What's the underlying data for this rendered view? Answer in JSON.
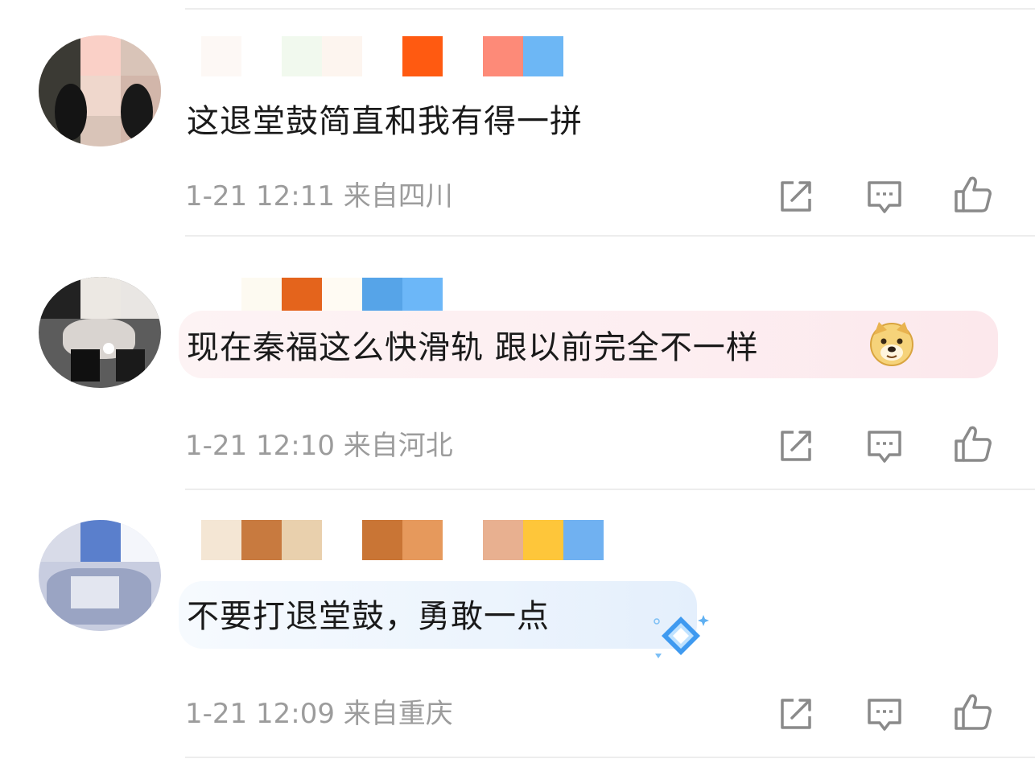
{
  "comments": [
    {
      "text": "这退堂鼓简直和我有得一拼",
      "time": "1-21 12:11",
      "location": "来自四川",
      "avatar_icon": "avatar-girl-icon",
      "name_blocks": [
        "#fdf8f5",
        "#f1f9ee",
        "#fdf5ef",
        "#ff5a11",
        "#fd8a78",
        "#6db7f5"
      ]
    },
    {
      "text": "现在秦福这么快滑轨 跟以前完全不一样",
      "emoji": "doge-emoji-icon",
      "time": "1-21 12:10",
      "location": "来自河北",
      "avatar_icon": "avatar-plush-icon",
      "name_blocks": [
        "#f7fafc",
        "#fdfaf1",
        "#e4641c",
        "#fffbf3",
        "#56a4e8",
        "#6cb7f8"
      ]
    },
    {
      "text": "不要打退堂鼓，勇敢一点",
      "sticker": "blue-diamond-sticker-icon",
      "time": "1-21 12:09",
      "location": "来自重庆",
      "avatar_icon": "avatar-anime-icon",
      "name_blocks": [
        "#f4e6d4",
        "#c87a3f",
        "#e9d0ad",
        "#c97535",
        "#e6995c",
        "#e8b090",
        "#fec63a",
        "#70b1f1"
      ]
    }
  ],
  "actions": {
    "share_icon": "share-icon",
    "comment_icon": "comment-icon",
    "like_icon": "thumbs-up-icon"
  },
  "colors": {
    "bubble_pink": "#fdecef",
    "bubble_blue": "#e9f3fd",
    "meta_gray": "#9c9c9c",
    "icon_gray": "#8a8a8a"
  }
}
